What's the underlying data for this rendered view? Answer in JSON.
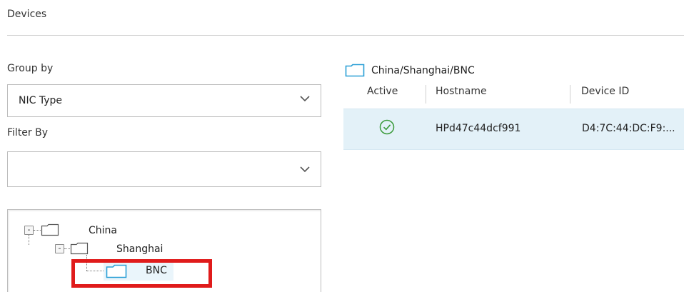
{
  "page": {
    "title": "Devices"
  },
  "filters": {
    "group_by_label": "Group by",
    "group_by_value": "NIC Type",
    "filter_by_label": "Filter By",
    "filter_by_value": ""
  },
  "tree": {
    "nodes": [
      {
        "label": "China",
        "level": 0,
        "toggle": "-",
        "icon": "folder-icon"
      },
      {
        "label": "Shanghai",
        "level": 1,
        "toggle": "-",
        "icon": "folder-icon"
      },
      {
        "label": "BNC",
        "level": 2,
        "selected": true,
        "icon": "folder-icon"
      }
    ]
  },
  "table": {
    "path": "China/Shanghai/BNC",
    "columns": [
      "Active",
      "Hostname",
      "Device ID"
    ],
    "rows": [
      {
        "active": true,
        "active_icon": "check-circle-icon",
        "hostname": "HPd47c44dcf991",
        "device_id": "D4:7C:44:DC:F9:..."
      }
    ]
  },
  "colors": {
    "accent": "#2a9fd6",
    "selected_row": "#e3f1f8",
    "active_check": "#3a9a3a",
    "annotation": "#e01b1b"
  }
}
